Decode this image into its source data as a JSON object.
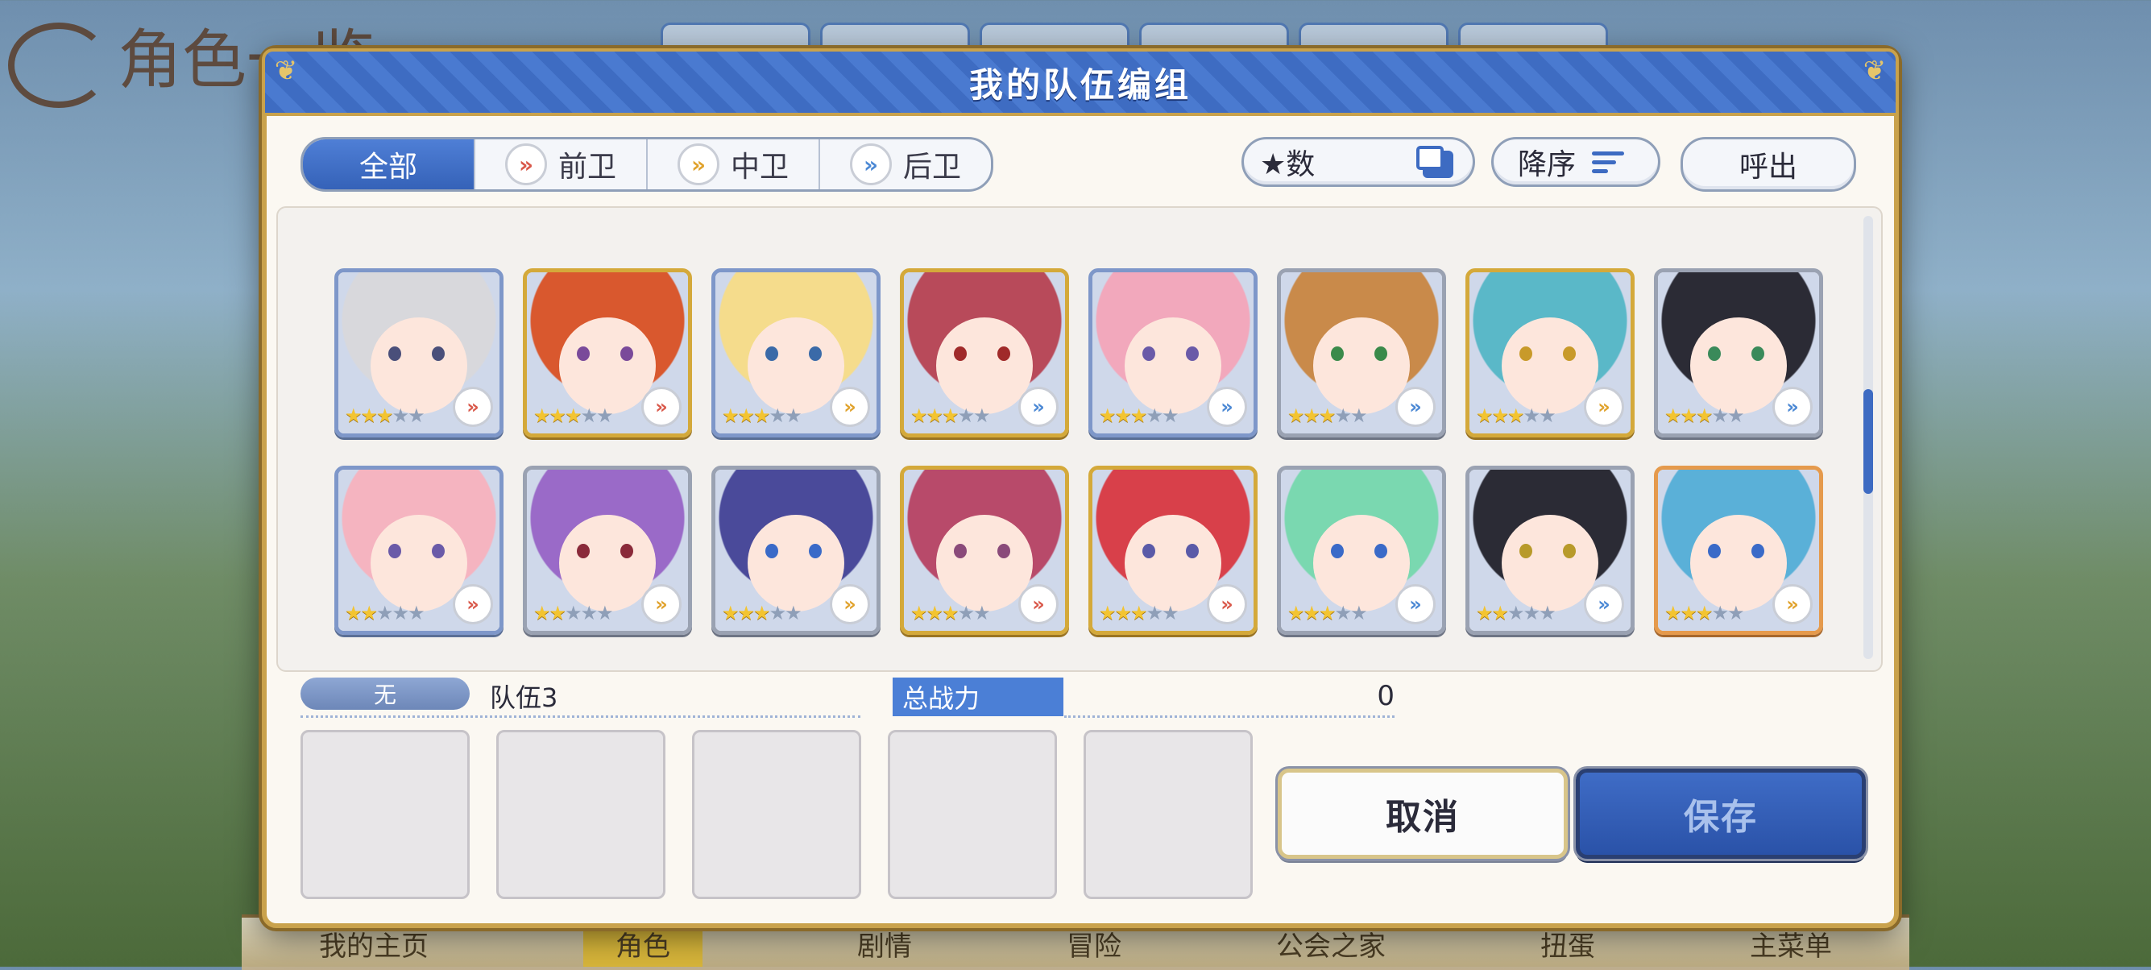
{
  "background": {
    "screen_title": "角色一览",
    "bottom_nav": [
      "我的主页",
      "角色",
      "剧情",
      "冒险",
      "公会之家",
      "扭蛋",
      "主菜单"
    ],
    "bottom_nav_active": "角色"
  },
  "dialog": {
    "title": "我的队伍编组",
    "filter_tabs": [
      {
        "label": "全部",
        "icon": null,
        "active": true
      },
      {
        "label": "前卫",
        "icon": "chevron-front-icon",
        "active": false
      },
      {
        "label": "中卫",
        "icon": "chevron-mid-icon",
        "active": false
      },
      {
        "label": "后卫",
        "icon": "chevron-back-icon",
        "active": false
      }
    ],
    "sort_key_label": "★数",
    "sort_order_label": "降序",
    "call_label": "呼出"
  },
  "colors": {
    "accent": "#3d6bc2",
    "gold_frame": "#d4a93a",
    "front_role": "#d9584a",
    "mid_role": "#e0a22c",
    "back_role": "#4b88d4"
  },
  "characters": [
    [
      {
        "stars": 3,
        "frame": "blue",
        "role": "front",
        "hair": "#d8d8dc",
        "eyes": "#4a4f7a"
      },
      {
        "stars": 3,
        "frame": "gold",
        "role": "front",
        "hair": "#d9582e",
        "eyes": "#7a4a9a"
      },
      {
        "stars": 3,
        "frame": "blue",
        "role": "mid",
        "hair": "#f5dc8c",
        "eyes": "#3a6aa8"
      },
      {
        "stars": 3,
        "frame": "gold",
        "role": "back",
        "hair": "#b84a5a",
        "eyes": "#a02a2a"
      },
      {
        "stars": 3,
        "frame": "blue",
        "role": "back",
        "hair": "#f2a8bc",
        "eyes": "#6a5aa8"
      },
      {
        "stars": 3,
        "frame": "silver",
        "role": "back",
        "hair": "#c98a4a",
        "eyes": "#3a8a4a"
      },
      {
        "stars": 3,
        "frame": "gold",
        "role": "mid",
        "hair": "#5ab8c8",
        "eyes": "#c89a2a"
      },
      {
        "stars": 3,
        "frame": "silver",
        "role": "back",
        "hair": "#2b2b35",
        "eyes": "#3a8a5a"
      }
    ],
    [
      {
        "stars": 2,
        "frame": "blue",
        "role": "front",
        "hair": "#f5b4c0",
        "eyes": "#6a5aa8"
      },
      {
        "stars": 2,
        "frame": "silver",
        "role": "mid",
        "hair": "#9a6ac8",
        "eyes": "#8a2a3a"
      },
      {
        "stars": 3,
        "frame": "silver",
        "role": "mid",
        "hair": "#4a4a9a",
        "eyes": "#3a6ac8"
      },
      {
        "stars": 3,
        "frame": "gold",
        "role": "front",
        "hair": "#b84a6a",
        "eyes": "#8a4a7a"
      },
      {
        "stars": 3,
        "frame": "gold",
        "role": "front",
        "hair": "#d8404a",
        "eyes": "#5a5aa8"
      },
      {
        "stars": 3,
        "frame": "silver",
        "role": "back",
        "hair": "#7ad8b0",
        "eyes": "#3a6ac8"
      },
      {
        "stars": 2,
        "frame": "silver",
        "role": "back",
        "hair": "#2b2b35",
        "eyes": "#b89a2a"
      },
      {
        "stars": 3,
        "frame": "orange",
        "role": "mid",
        "hair": "#5ab0d8",
        "eyes": "#3a6ac8"
      }
    ]
  ],
  "team": {
    "none_label": "无",
    "name": "队伍3",
    "power_label": "总战力",
    "power_value": "0",
    "slots": 5
  },
  "buttons": {
    "cancel": "取消",
    "save": "保存"
  }
}
